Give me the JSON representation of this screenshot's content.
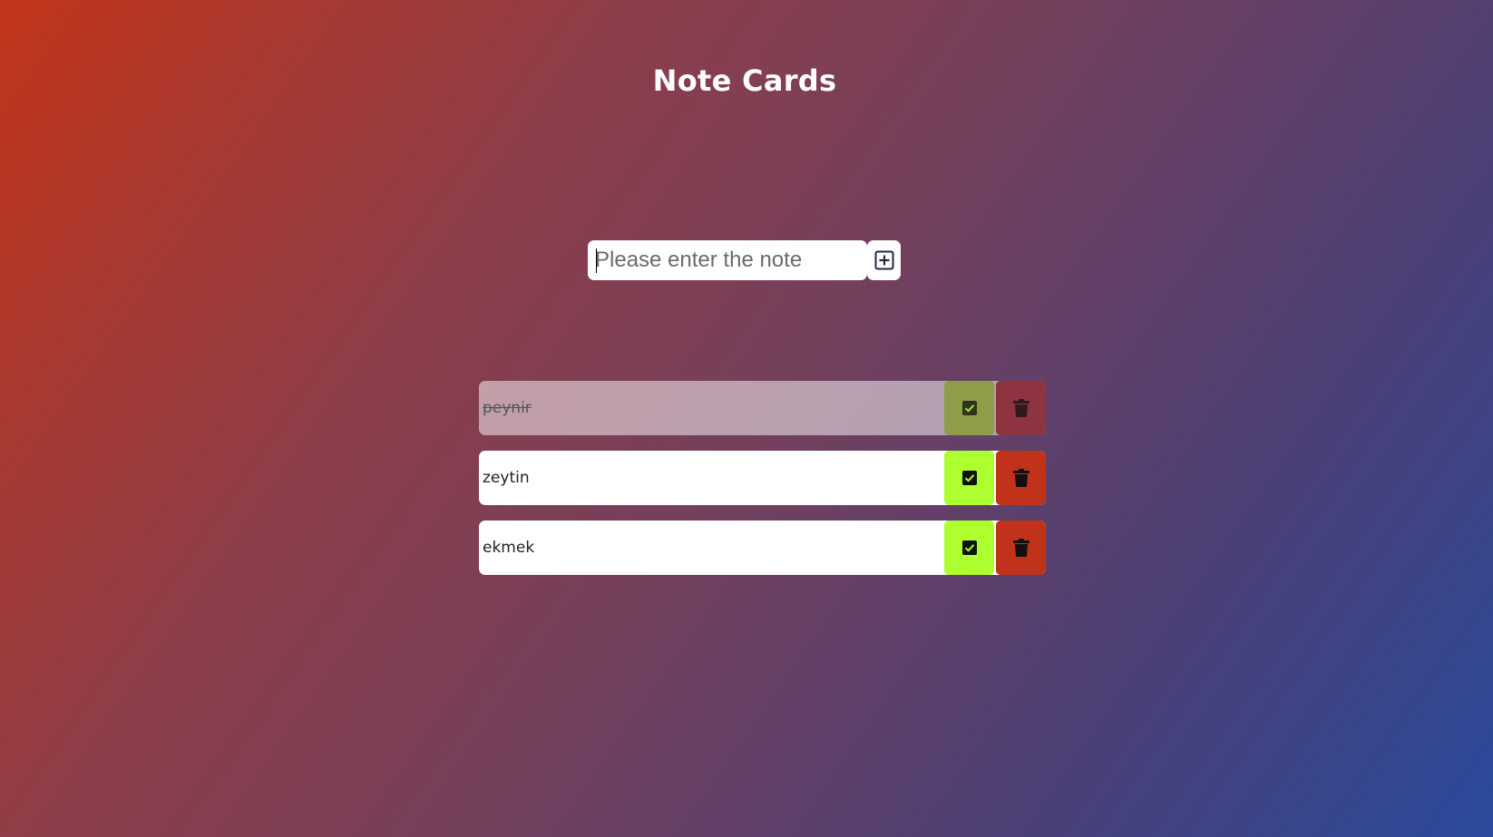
{
  "header": {
    "title": "Note Cards"
  },
  "input": {
    "placeholder": "Please enter the note",
    "value": ""
  },
  "add_button": {
    "icon": "plus-square-icon"
  },
  "notes": [
    {
      "text": "peynir",
      "done": true
    },
    {
      "text": "zeytin",
      "done": false
    },
    {
      "text": "ekmek",
      "done": false
    }
  ],
  "colors": {
    "check_button": "#adff2f",
    "delete_button": "#c0321a",
    "gradient_start": "#c2351a",
    "gradient_end": "#2a4a9c"
  }
}
